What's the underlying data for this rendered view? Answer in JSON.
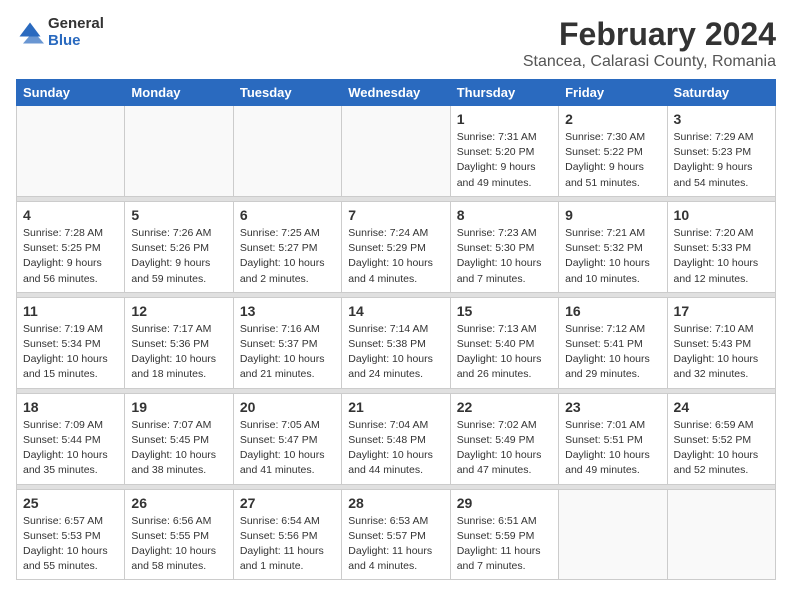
{
  "logo": {
    "general": "General",
    "blue": "Blue"
  },
  "title": "February 2024",
  "subtitle": "Stancea, Calarasi County, Romania",
  "days_header": [
    "Sunday",
    "Monday",
    "Tuesday",
    "Wednesday",
    "Thursday",
    "Friday",
    "Saturday"
  ],
  "weeks": [
    [
      {
        "day": "",
        "info": ""
      },
      {
        "day": "",
        "info": ""
      },
      {
        "day": "",
        "info": ""
      },
      {
        "day": "",
        "info": ""
      },
      {
        "day": "1",
        "info": "Sunrise: 7:31 AM\nSunset: 5:20 PM\nDaylight: 9 hours\nand 49 minutes."
      },
      {
        "day": "2",
        "info": "Sunrise: 7:30 AM\nSunset: 5:22 PM\nDaylight: 9 hours\nand 51 minutes."
      },
      {
        "day": "3",
        "info": "Sunrise: 7:29 AM\nSunset: 5:23 PM\nDaylight: 9 hours\nand 54 minutes."
      }
    ],
    [
      {
        "day": "4",
        "info": "Sunrise: 7:28 AM\nSunset: 5:25 PM\nDaylight: 9 hours\nand 56 minutes."
      },
      {
        "day": "5",
        "info": "Sunrise: 7:26 AM\nSunset: 5:26 PM\nDaylight: 9 hours\nand 59 minutes."
      },
      {
        "day": "6",
        "info": "Sunrise: 7:25 AM\nSunset: 5:27 PM\nDaylight: 10 hours\nand 2 minutes."
      },
      {
        "day": "7",
        "info": "Sunrise: 7:24 AM\nSunset: 5:29 PM\nDaylight: 10 hours\nand 4 minutes."
      },
      {
        "day": "8",
        "info": "Sunrise: 7:23 AM\nSunset: 5:30 PM\nDaylight: 10 hours\nand 7 minutes."
      },
      {
        "day": "9",
        "info": "Sunrise: 7:21 AM\nSunset: 5:32 PM\nDaylight: 10 hours\nand 10 minutes."
      },
      {
        "day": "10",
        "info": "Sunrise: 7:20 AM\nSunset: 5:33 PM\nDaylight: 10 hours\nand 12 minutes."
      }
    ],
    [
      {
        "day": "11",
        "info": "Sunrise: 7:19 AM\nSunset: 5:34 PM\nDaylight: 10 hours\nand 15 minutes."
      },
      {
        "day": "12",
        "info": "Sunrise: 7:17 AM\nSunset: 5:36 PM\nDaylight: 10 hours\nand 18 minutes."
      },
      {
        "day": "13",
        "info": "Sunrise: 7:16 AM\nSunset: 5:37 PM\nDaylight: 10 hours\nand 21 minutes."
      },
      {
        "day": "14",
        "info": "Sunrise: 7:14 AM\nSunset: 5:38 PM\nDaylight: 10 hours\nand 24 minutes."
      },
      {
        "day": "15",
        "info": "Sunrise: 7:13 AM\nSunset: 5:40 PM\nDaylight: 10 hours\nand 26 minutes."
      },
      {
        "day": "16",
        "info": "Sunrise: 7:12 AM\nSunset: 5:41 PM\nDaylight: 10 hours\nand 29 minutes."
      },
      {
        "day": "17",
        "info": "Sunrise: 7:10 AM\nSunset: 5:43 PM\nDaylight: 10 hours\nand 32 minutes."
      }
    ],
    [
      {
        "day": "18",
        "info": "Sunrise: 7:09 AM\nSunset: 5:44 PM\nDaylight: 10 hours\nand 35 minutes."
      },
      {
        "day": "19",
        "info": "Sunrise: 7:07 AM\nSunset: 5:45 PM\nDaylight: 10 hours\nand 38 minutes."
      },
      {
        "day": "20",
        "info": "Sunrise: 7:05 AM\nSunset: 5:47 PM\nDaylight: 10 hours\nand 41 minutes."
      },
      {
        "day": "21",
        "info": "Sunrise: 7:04 AM\nSunset: 5:48 PM\nDaylight: 10 hours\nand 44 minutes."
      },
      {
        "day": "22",
        "info": "Sunrise: 7:02 AM\nSunset: 5:49 PM\nDaylight: 10 hours\nand 47 minutes."
      },
      {
        "day": "23",
        "info": "Sunrise: 7:01 AM\nSunset: 5:51 PM\nDaylight: 10 hours\nand 49 minutes."
      },
      {
        "day": "24",
        "info": "Sunrise: 6:59 AM\nSunset: 5:52 PM\nDaylight: 10 hours\nand 52 minutes."
      }
    ],
    [
      {
        "day": "25",
        "info": "Sunrise: 6:57 AM\nSunset: 5:53 PM\nDaylight: 10 hours\nand 55 minutes."
      },
      {
        "day": "26",
        "info": "Sunrise: 6:56 AM\nSunset: 5:55 PM\nDaylight: 10 hours\nand 58 minutes."
      },
      {
        "day": "27",
        "info": "Sunrise: 6:54 AM\nSunset: 5:56 PM\nDaylight: 11 hours\nand 1 minute."
      },
      {
        "day": "28",
        "info": "Sunrise: 6:53 AM\nSunset: 5:57 PM\nDaylight: 11 hours\nand 4 minutes."
      },
      {
        "day": "29",
        "info": "Sunrise: 6:51 AM\nSunset: 5:59 PM\nDaylight: 11 hours\nand 7 minutes."
      },
      {
        "day": "",
        "info": ""
      },
      {
        "day": "",
        "info": ""
      }
    ]
  ]
}
